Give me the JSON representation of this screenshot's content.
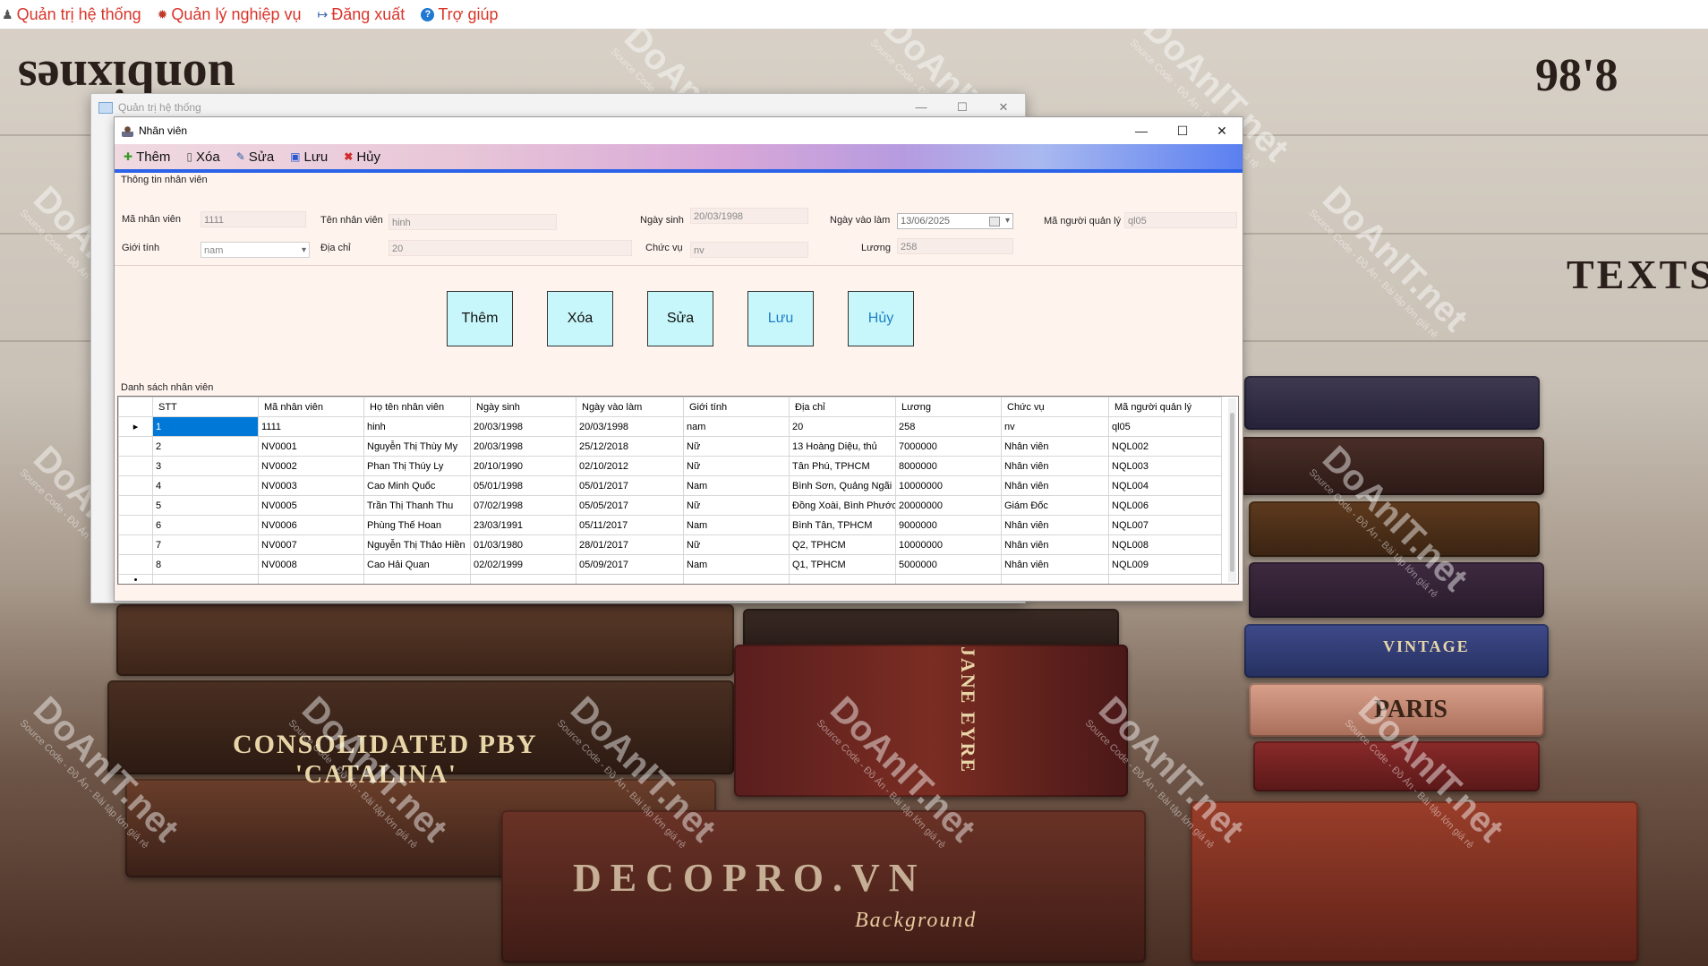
{
  "top_menu": {
    "items": [
      {
        "label": "Quản trị hệ thống",
        "icon": "user-icon"
      },
      {
        "label": "Quản lý nghiệp vụ",
        "icon": "gear-icon"
      },
      {
        "label": "Đăng xuất",
        "icon": "logout-icon"
      },
      {
        "label": "Trợ giúp",
        "icon": "help-icon"
      }
    ]
  },
  "outer_window": {
    "title": "Quản trị hệ thống"
  },
  "inner_window": {
    "title": "Nhân viên"
  },
  "toolbar": {
    "add": "Thêm",
    "delete": "Xóa",
    "edit": "Sửa",
    "save": "Lưu",
    "cancel": "Hủy"
  },
  "form": {
    "group_label": "Thông tin nhân viên",
    "employee_id_label": "Mã nhân viên",
    "employee_id": "1111",
    "employee_name_label": "Tên nhân viên",
    "employee_name": "hinh",
    "birth_date_label": "Ngày sinh",
    "birth_date": "20/03/1998",
    "hire_date_label": "Ngày vào làm",
    "hire_date": "13/06/2025",
    "manager_id_label": "Mã người quản lý",
    "manager_id": "ql05",
    "gender_label": "Giới tính",
    "gender": "nam",
    "address_label": "Địa chỉ",
    "address": "20",
    "position_label": "Chức vụ",
    "position": "nv",
    "salary_label": "Lương",
    "salary": "258"
  },
  "buttons": {
    "add": "Thêm",
    "delete": "Xóa",
    "edit": "Sửa",
    "save": "Lưu",
    "cancel": "Hủy"
  },
  "list": {
    "label": "Danh sách nhân viên",
    "columns": [
      "STT",
      "Mã nhân viên",
      "Họ tên nhân viên",
      "Ngày sinh",
      "Ngày vào làm",
      "Giới tính",
      "Địa chỉ",
      "Lương",
      "Chức vụ",
      "Mã người quản lý"
    ],
    "rows": [
      [
        "1",
        "1111",
        "hinh",
        "20/03/1998",
        "20/03/1998",
        "nam",
        "20",
        "258",
        "nv",
        "ql05"
      ],
      [
        "2",
        "NV0001",
        "Nguyễn Thị Thùy My",
        "20/03/1998",
        "25/12/2018",
        "Nữ",
        "13 Hoàng Diệu, thủ",
        "7000000",
        "Nhân viên",
        "NQL002"
      ],
      [
        "3",
        "NV0002",
        "Phan Thị Thúy Ly",
        "20/10/1990",
        "02/10/2012",
        "Nữ",
        "Tân Phú, TPHCM",
        "8000000",
        "Nhân viên",
        "NQL003"
      ],
      [
        "4",
        "NV0003",
        "Cao Minh Quốc",
        "05/01/1998",
        "05/01/2017",
        "Nam",
        "Bình Sơn, Quảng Ngãi",
        "10000000",
        "Nhân viên",
        "NQL004"
      ],
      [
        "5",
        "NV0005",
        "Trần Thị Thanh Thu",
        "07/02/1998",
        "05/05/2017",
        "Nữ",
        "Đồng Xoài, Bình Phước",
        "20000000",
        "Giám Đốc",
        "NQL006"
      ],
      [
        "6",
        "NV0006",
        "Phùng Thế Hoan",
        "23/03/1991",
        "05/11/2017",
        "Nam",
        "Bình Tân, TPHCM",
        "9000000",
        "Nhân viên",
        "NQL007"
      ],
      [
        "7",
        "NV0007",
        "Nguyễn Thị Thảo Hiền",
        "01/03/1980",
        "28/01/2017",
        "Nữ",
        "Q2, TPHCM",
        "10000000",
        "Nhân viên",
        "NQL008"
      ],
      [
        "8",
        "NV0008",
        "Cao Hải Quan",
        "02/02/1999",
        "05/09/2017",
        "Nam",
        "Q1, TPHCM",
        "5000000",
        "Nhân viên",
        "NQL009"
      ]
    ]
  },
  "background": {
    "texts": [
      "uonbixnes",
      "98'8",
      "CONSOLIDATED PBY",
      "'CATALINA'",
      "DECOPRO.VN",
      "VINTAGE",
      "Background",
      "PARIS",
      "JANE EYRE",
      "TEXTS"
    ],
    "watermark": "DoAnIT.net",
    "watermark_sub": "Source Code - Đồ Án - Bài tập lớn giá rẻ"
  }
}
